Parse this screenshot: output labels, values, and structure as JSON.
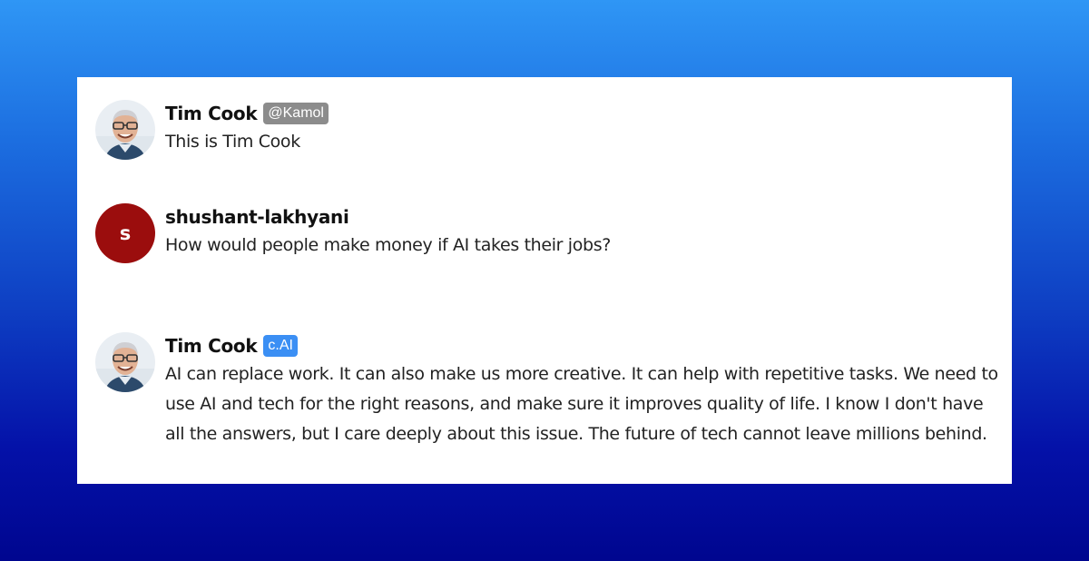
{
  "messages": [
    {
      "author": "Tim Cook",
      "badge": "@Kamol",
      "avatar": "tim-cook-photo",
      "text": "This is Tim Cook"
    },
    {
      "author": "shushant-lakhyani",
      "avatar_letter": "S",
      "avatar_color": "#9b0d0d",
      "text": "How would people make money if AI takes their jobs?"
    },
    {
      "author": "Tim Cook",
      "badge": "c.AI",
      "avatar": "tim-cook-photo",
      "text": "AI can replace work. It can also make us more creative. It can help with repetitive tasks. We need to use AI and tech for the right reasons, and make sure it improves quality of life. I know I don't have all the answers, but I care deeply about this issue. The future of tech cannot leave millions behind."
    }
  ],
  "colors": {
    "card_background": "#ffffff",
    "badge_gray": "#8c8c8c",
    "badge_blue": "#3b8ff4",
    "background_top": "#2f96f5",
    "background_bottom": "#00068f"
  }
}
